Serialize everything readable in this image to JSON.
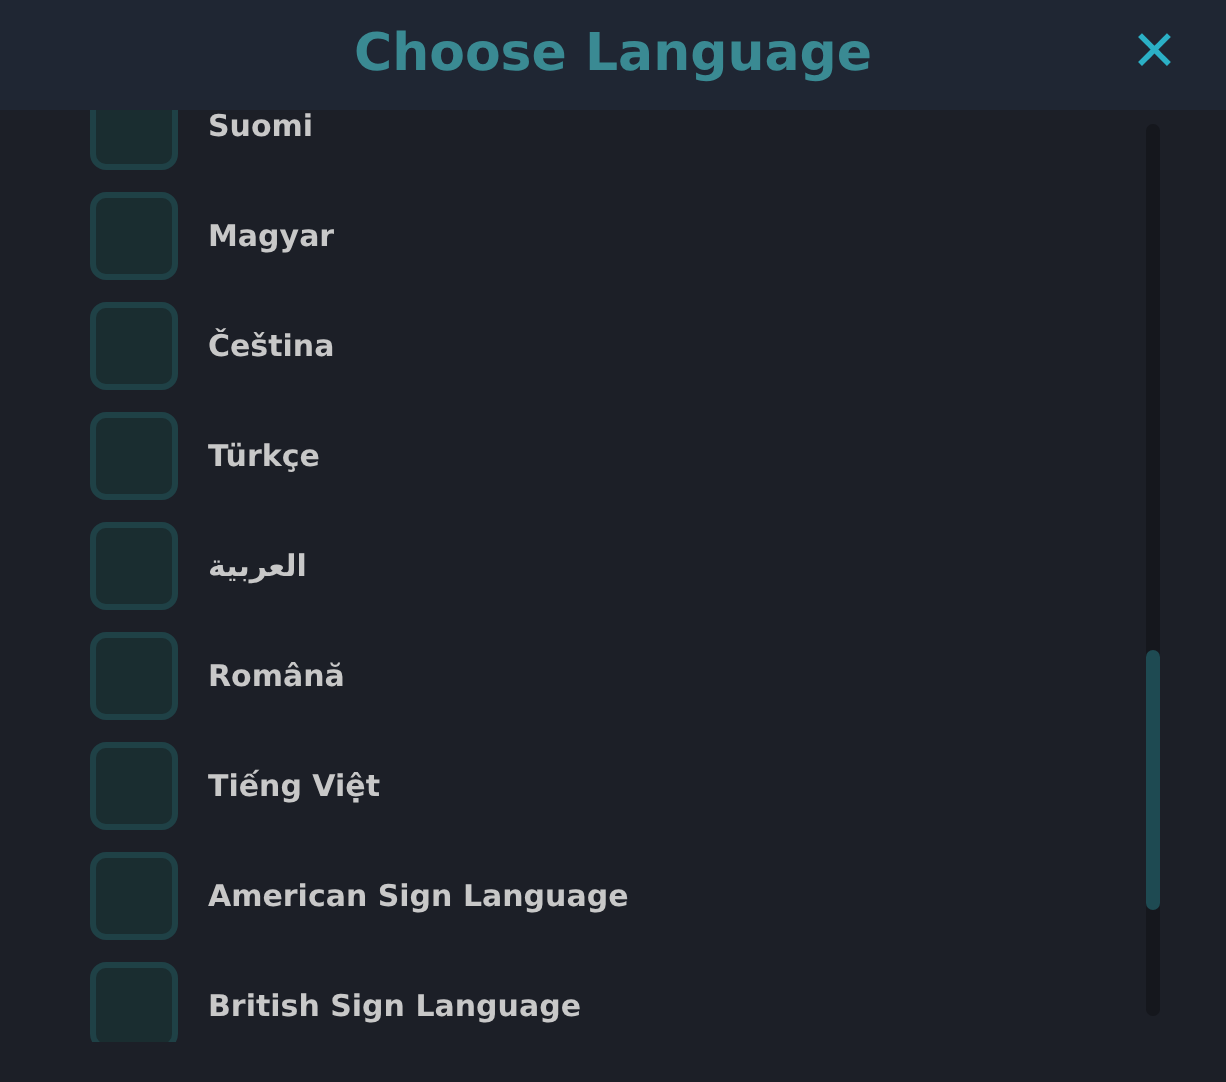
{
  "dialog": {
    "title": "Choose Language",
    "close": "✕"
  },
  "languages": [
    {
      "label": "Suomi",
      "checked": false
    },
    {
      "label": "Magyar",
      "checked": false
    },
    {
      "label": "Čeština",
      "checked": false
    },
    {
      "label": "Türkçe",
      "checked": false
    },
    {
      "label": "العربية",
      "checked": false
    },
    {
      "label": "Română",
      "checked": false
    },
    {
      "label": "Tiếng Việt",
      "checked": false
    },
    {
      "label": "American Sign Language",
      "checked": false
    },
    {
      "label": "British Sign Language",
      "checked": false
    }
  ]
}
